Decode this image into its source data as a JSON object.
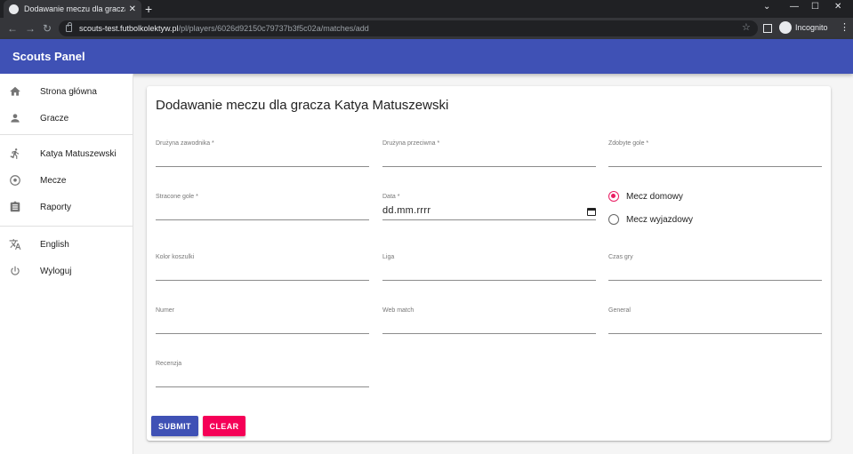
{
  "browser": {
    "tab_title": "Dodawanie meczu dla gracza Kat",
    "tab_close": "✕",
    "new_tab": "+",
    "url_host": "scouts-test.futbolkolektyw.pl",
    "url_path": "/pl/players/6026d92150c79737b3f5c02a/matches/add",
    "incognito_label": "Incognito",
    "window_controls": [
      "⌄",
      "—",
      "☐",
      "✕"
    ]
  },
  "app": {
    "title": "Scouts Panel"
  },
  "sidebar": {
    "items": [
      {
        "label": "Strona główna",
        "icon": "home-icon"
      },
      {
        "label": "Gracze",
        "icon": "person-icon"
      },
      {
        "label": "Katya Matuszewski",
        "icon": "running-icon"
      },
      {
        "label": "Mecze",
        "icon": "soccer-ball-icon"
      },
      {
        "label": "Raporty",
        "icon": "clipboard-icon"
      },
      {
        "label": "English",
        "icon": "translate-icon"
      },
      {
        "label": "Wyloguj",
        "icon": "power-icon"
      }
    ]
  },
  "form": {
    "title": "Dodawanie meczu dla gracza Katya Matuszewski",
    "fields": {
      "my_team": {
        "label": "Drużyna zawodnika *",
        "value": ""
      },
      "enemy_team": {
        "label": "Drużyna przeciwna *",
        "value": ""
      },
      "my_goals": {
        "label": "Zdobyte gole *",
        "value": ""
      },
      "enemy_goals": {
        "label": "Stracone gole *",
        "value": ""
      },
      "date": {
        "label": "Data *",
        "value": "dd.mm.rrrr"
      },
      "tshirt_color": {
        "label": "Kolor koszulki",
        "value": ""
      },
      "league": {
        "label": "Liga",
        "value": ""
      },
      "time_played": {
        "label": "Czas gry",
        "value": ""
      },
      "number": {
        "label": "Numer",
        "value": ""
      },
      "web_match": {
        "label": "Web match",
        "value": ""
      },
      "general": {
        "label": "General",
        "value": ""
      },
      "review": {
        "label": "Recenzja",
        "value": ""
      }
    },
    "radio": {
      "home": {
        "label": "Mecz domowy",
        "checked": true
      },
      "away": {
        "label": "Mecz wyjazdowy",
        "checked": false
      }
    },
    "buttons": {
      "submit": "SUBMIT",
      "clear": "CLEAR"
    }
  },
  "colors": {
    "primary": "#3f51b5",
    "secondary": "#f50057",
    "radio_accent": "#e91e63"
  }
}
